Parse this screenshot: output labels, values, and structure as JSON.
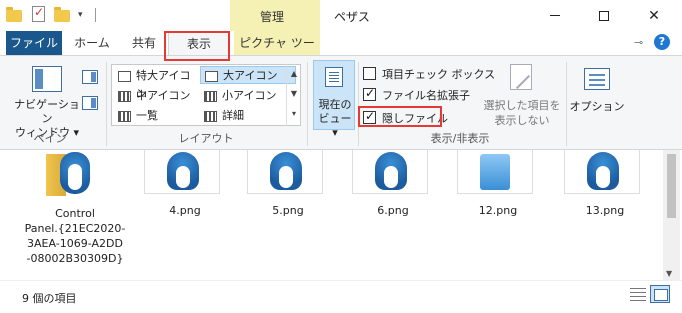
{
  "titlebar": {
    "tool_context": "管理",
    "window_title": "ペザス",
    "qat_dropdown": "▾"
  },
  "tabs": {
    "file": "ファイル",
    "home": "ホーム",
    "share": "共有",
    "view": "表示",
    "picture_tools": "ピクチャ ツール"
  },
  "ribbon": {
    "pane": {
      "nav_pane": "ナビゲーション\nウィンドウ ▾",
      "group": "ペイン"
    },
    "layout": {
      "items": [
        "特大アイコン",
        "大アイコン",
        "中アイコン",
        "小アイコン",
        "一覧",
        "詳細"
      ],
      "selected": "大アイコン",
      "group": "レイアウト"
    },
    "current_view": {
      "label": "現在の\nビュー ▾"
    },
    "show_hide": {
      "item_checkboxes": "項目チェック ボックス",
      "item_checkboxes_checked": false,
      "file_extensions": "ファイル名拡張子",
      "file_extensions_checked": true,
      "hidden_items": "隠しファイル",
      "hidden_items_checked": true,
      "hide_selected": "選択した項目を\n表示しない",
      "group": "表示/非表示"
    },
    "options": {
      "label": "オプション"
    }
  },
  "content": {
    "files": [
      {
        "name": "Control Panel.{21EC2020-3AEA-1069-A2DD-08002B30309D}",
        "lines": [
          "Control",
          "Panel.{21EC2020-",
          "3AEA-1069-A2DD",
          "-08002B30309D}"
        ]
      },
      {
        "name": "4.png"
      },
      {
        "name": "5.png"
      },
      {
        "name": "6.png"
      },
      {
        "name": "12.png"
      },
      {
        "name": "13.png"
      }
    ]
  },
  "statusbar": {
    "count": "9 個の項目"
  },
  "colors": {
    "file_tab": "#19578d",
    "context_tab": "#f5f1b4",
    "highlight_box": "#e53935",
    "selection": "#cce4f7"
  }
}
